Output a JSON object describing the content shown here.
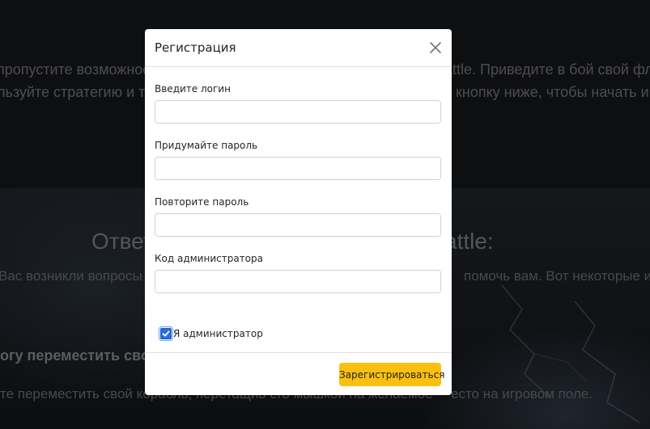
{
  "background": {
    "line1_left": "пропустите возможност",
    "line1_right": "attle. Приведите в бой свой фл",
    "line2_left": "льзуйте стратегию и т",
    "line2_right": "кнопку ниже, чтобы начать игр",
    "heading_left": "Ответ",
    "heading_right": "attle:",
    "line3_left": "Вас возникли вопросы",
    "line3_right": "помочь вам. Вот некоторые из",
    "bold_line": "огу переместить сво",
    "line4_left": "те переместить свой корабль, перетащив его мышкой на желаемое",
    "line4_right": "есто на игровом поле."
  },
  "modal": {
    "title": "Регистрация",
    "close_icon": "close-icon",
    "fields": {
      "login_label": "Введите логин",
      "login_value": "",
      "password_label": "Придумайте пароль",
      "password_value": "",
      "repeat_label": "Повторите пароль",
      "repeat_value": "",
      "admin_code_label": "Код администратора",
      "admin_code_value": ""
    },
    "admin_checkbox": {
      "label": "Я администратор",
      "checked": true
    },
    "submit_label": "Зарегистрироваться"
  },
  "colors": {
    "accent_button": "#fbbf0f",
    "checkbox": "#2b6cd9",
    "backdrop": "rgba(0,0,0,0.5)"
  }
}
